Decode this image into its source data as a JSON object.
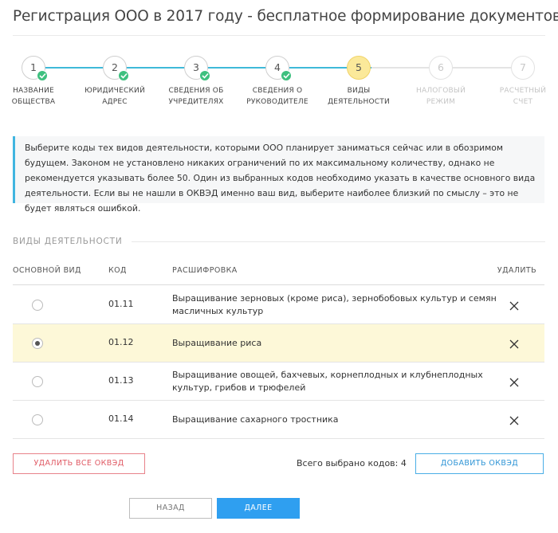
{
  "page": {
    "title": "Регистрация ООО в 2017 году - бесплатное формирование документов"
  },
  "steps": [
    {
      "number": "1",
      "label_line1": "НАЗВАНИЕ",
      "label_line2": "ОБЩЕСТВА",
      "state": "done"
    },
    {
      "number": "2",
      "label_line1": "ЮРИДИЧЕСКИЙ",
      "label_line2": "АДРЕС",
      "state": "done"
    },
    {
      "number": "3",
      "label_line1": "СВЕДЕНИЯ ОБ",
      "label_line2": "УЧРЕДИТЕЛЯХ",
      "state": "done"
    },
    {
      "number": "4",
      "label_line1": "СВЕДЕНИЯ О",
      "label_line2": "РУКОВОДИТЕЛЕ",
      "state": "done"
    },
    {
      "number": "5",
      "label_line1": "ВИДЫ",
      "label_line2": "ДЕЯТЕЛЬНОСТИ",
      "state": "active"
    },
    {
      "number": "6",
      "label_line1": "НАЛОГОВЫЙ",
      "label_line2": "РЕЖИМ",
      "state": "inactive"
    },
    {
      "number": "7",
      "label_line1": "РАСЧЕТНЫЙ",
      "label_line2": "СЧЕТ",
      "state": "inactive"
    }
  ],
  "info": {
    "text": "Выберите коды тех видов деятельности, которыми ООО планирует заниматься сейчас или в обозримом будущем. Законом не установлено никаких ограничений по их максимальному количеству, однако не рекомендуется указывать более 50. Один из выбранных кодов необходимо указать в качестве основного вида деятельности. Если вы не нашли в ОКВЭД именно ваш вид, выберите наиболее близкий по смыслу – это не будет являться ошибкой."
  },
  "section": {
    "title": "ВИДЫ ДЕЯТЕЛЬНОСТИ"
  },
  "table": {
    "headers": {
      "main": "ОСНОВНОЙ ВИД",
      "code": "КОД",
      "desc": "РАСШИФРОВКА",
      "del": "УДАЛИТЬ"
    },
    "rows": [
      {
        "code": "01.11",
        "desc": "Выращивание зерновых (кроме риса), зернобобовых культур и семян масличных культур",
        "main": false
      },
      {
        "code": "01.12",
        "desc": "Выращивание риса",
        "main": true
      },
      {
        "code": "01.13",
        "desc": "Выращивание овощей, бахчевых, корнеплодных и клубнеплодных культур, грибов и трюфелей",
        "main": false
      },
      {
        "code": "01.14",
        "desc": "Выращивание сахарного тростника",
        "main": false
      }
    ]
  },
  "actions": {
    "delete_all": "УДАЛИТЬ ВСЕ ОКВЭД",
    "total": "Всего выбрано кодов: 4",
    "add": "ДОБАВИТЬ ОКВЭД",
    "back": "НАЗАД",
    "next": "ДАЛЕЕ"
  },
  "colors": {
    "accent": "#2f9ff0",
    "step_line": "#3fb9d8",
    "done_check": "#3ec07f",
    "active_step": "#fbe99a",
    "selected_row": "#fdf8d8",
    "danger": "#e05a64"
  }
}
